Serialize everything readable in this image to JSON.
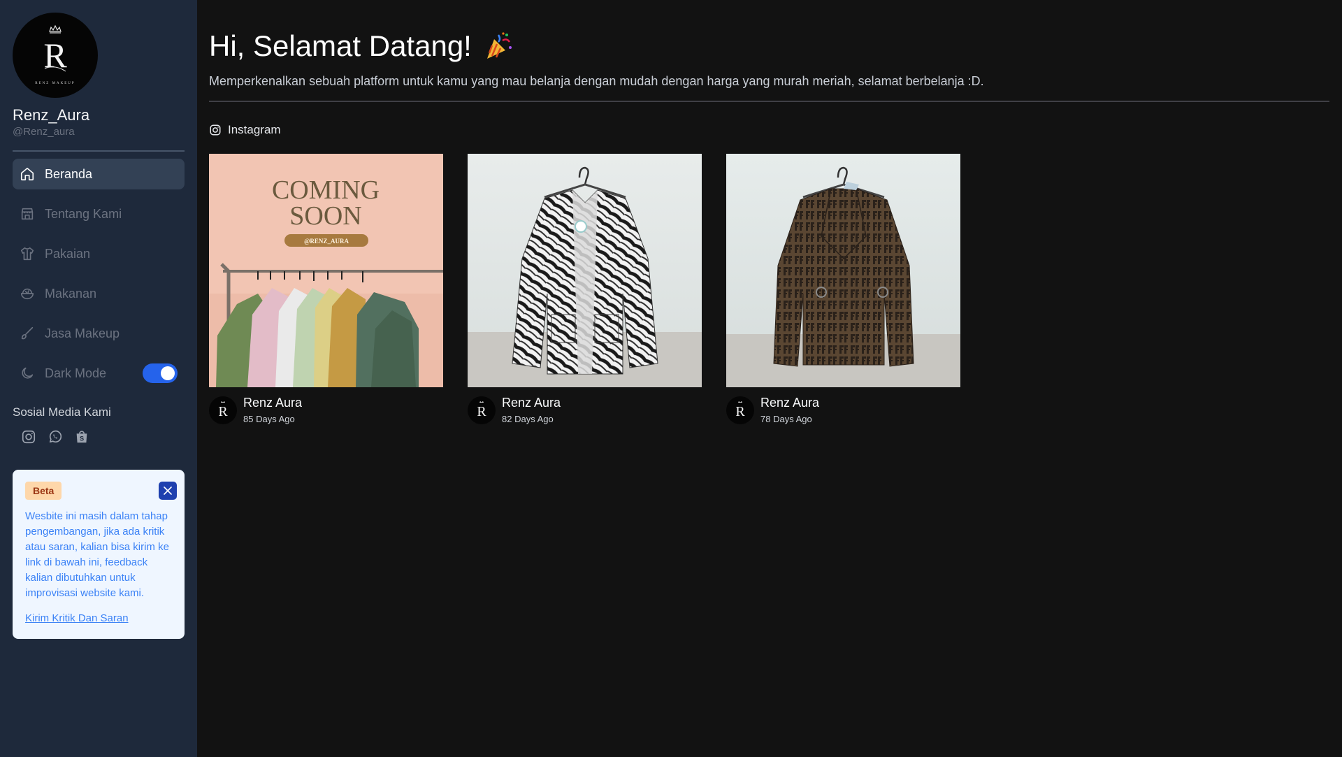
{
  "profile": {
    "logo_letter": "R",
    "logo_tagline": "RENZ MAKEUP",
    "name": "Renz_Aura",
    "handle": "@Renz_aura"
  },
  "nav": {
    "items": [
      {
        "label": "Beranda",
        "icon": "home-icon",
        "active": true
      },
      {
        "label": "Tentang Kami",
        "icon": "store-icon",
        "active": false
      },
      {
        "label": "Pakaian",
        "icon": "shirt-icon",
        "active": false
      },
      {
        "label": "Makanan",
        "icon": "bowl-icon",
        "active": false
      },
      {
        "label": "Jasa Makeup",
        "icon": "brush-icon",
        "active": false
      }
    ],
    "dark_mode": {
      "label": "Dark Mode",
      "icon": "moon-icon",
      "enabled": true
    }
  },
  "social": {
    "title": "Sosial Media Kami",
    "icons": [
      "instagram-icon",
      "whatsapp-icon",
      "shopee-icon"
    ]
  },
  "beta": {
    "badge": "Beta",
    "text": "Wesbite ini masih dalam tahap pengembangan, jika ada kritik atau saran, kalian bisa kirim ke link di bawah ini, feedback kalian dibutuhkan untuk improvisasi website kami.",
    "link": "Kirim Kritik Dan Saran"
  },
  "main": {
    "title": "Hi, Selamat Datang!",
    "subtitle": "Memperkenalkan sebuah platform untuk kamu yang mau belanja dengan mudah dengan harga yang murah meriah, selamat berbelanja :D.",
    "section_label": "Instagram"
  },
  "posts": [
    {
      "author": "Renz Aura",
      "time": "85 Days Ago",
      "image": "coming-soon-poster",
      "poster_line1": "COMING",
      "poster_line2": "SOON",
      "poster_tag": "@RENZ_AURA"
    },
    {
      "author": "Renz Aura",
      "time": "82 Days Ago",
      "image": "zebra-print-cardigan"
    },
    {
      "author": "Renz Aura",
      "time": "78 Days Ago",
      "image": "brown-monogram-jacket"
    }
  ],
  "colors": {
    "sidebar_bg": "#1e293b",
    "main_bg": "#121212",
    "accent": "#2563eb",
    "beta_bg": "#eff6ff"
  }
}
